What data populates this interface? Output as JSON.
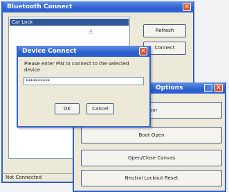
{
  "main_window": {
    "title": "Bluetooth Connect",
    "selected_item": "Car Lock"
  },
  "buttons": {
    "refresh": "Refresh",
    "connect": "Connect"
  },
  "status": "Not Connected",
  "dialog": {
    "title": "Device Connect",
    "prompt": "Please enter PIN to connect to the selected device",
    "pin_value": "**********",
    "ok": "OK",
    "cancel": "Cancel"
  },
  "options_window": {
    "title": "Options",
    "buttons": [
      "Door",
      "Boot Open",
      "Open/Close Canvas",
      "Neutral Lockout Reset"
    ]
  }
}
